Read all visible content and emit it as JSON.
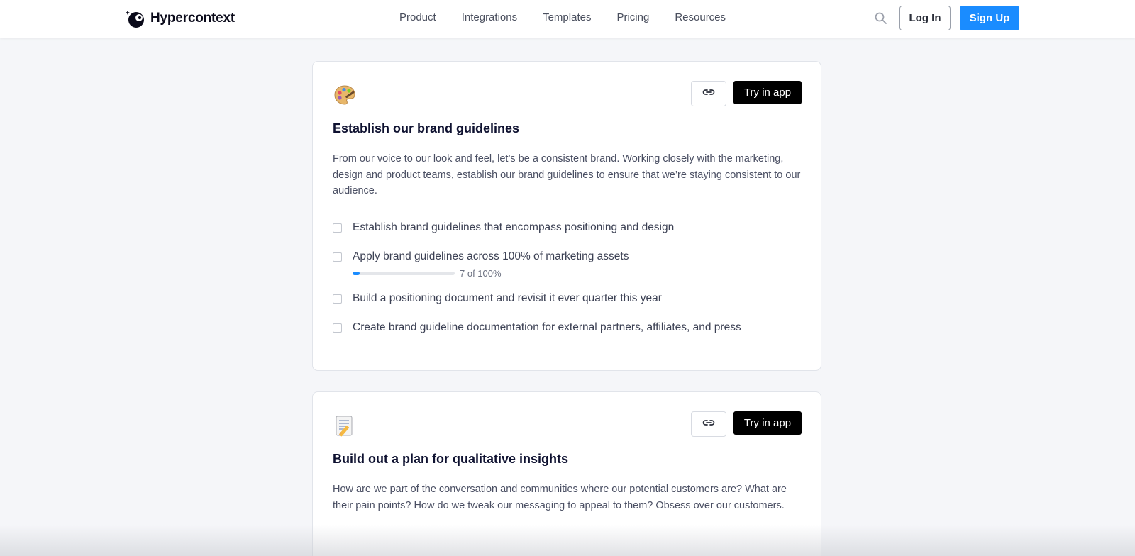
{
  "header": {
    "logo_text": "Hypercontext",
    "nav": [
      "Product",
      "Integrations",
      "Templates",
      "Pricing",
      "Resources"
    ],
    "login_label": "Log In",
    "signup_label": "Sign Up",
    "search_icon": "search-icon"
  },
  "colors": {
    "accent": "#1a8cff",
    "try_button": "#000000",
    "page_bg": "#f5f6f9"
  },
  "cards": [
    {
      "emoji": "palette-icon",
      "title": "Establish our brand guidelines",
      "description": "From our voice to our look and feel, let’s be a consistent brand. Working closely with the marketing, design and product teams, establish our brand guidelines to ensure that we’re staying consistent to our audience.",
      "try_label": "Try in app",
      "tasks": [
        {
          "text": "Establish brand guidelines that encompass positioning and design"
        },
        {
          "text": "Apply brand guidelines across 100% of marketing assets",
          "progress_label": "7 of 100%",
          "progress": 0.07
        },
        {
          "text": "Build a positioning document and revisit it ever quarter this year"
        },
        {
          "text": "Create brand guideline documentation for external partners, affiliates, and press"
        }
      ]
    },
    {
      "emoji": "memo-icon",
      "title": "Build out a plan for qualitative insights",
      "description": "How are we part of the conversation and communities where our potential customers are? What are their pain points? How do we tweak our messaging to appeal to them? Obsess over our customers.",
      "try_label": "Try in app"
    }
  ]
}
